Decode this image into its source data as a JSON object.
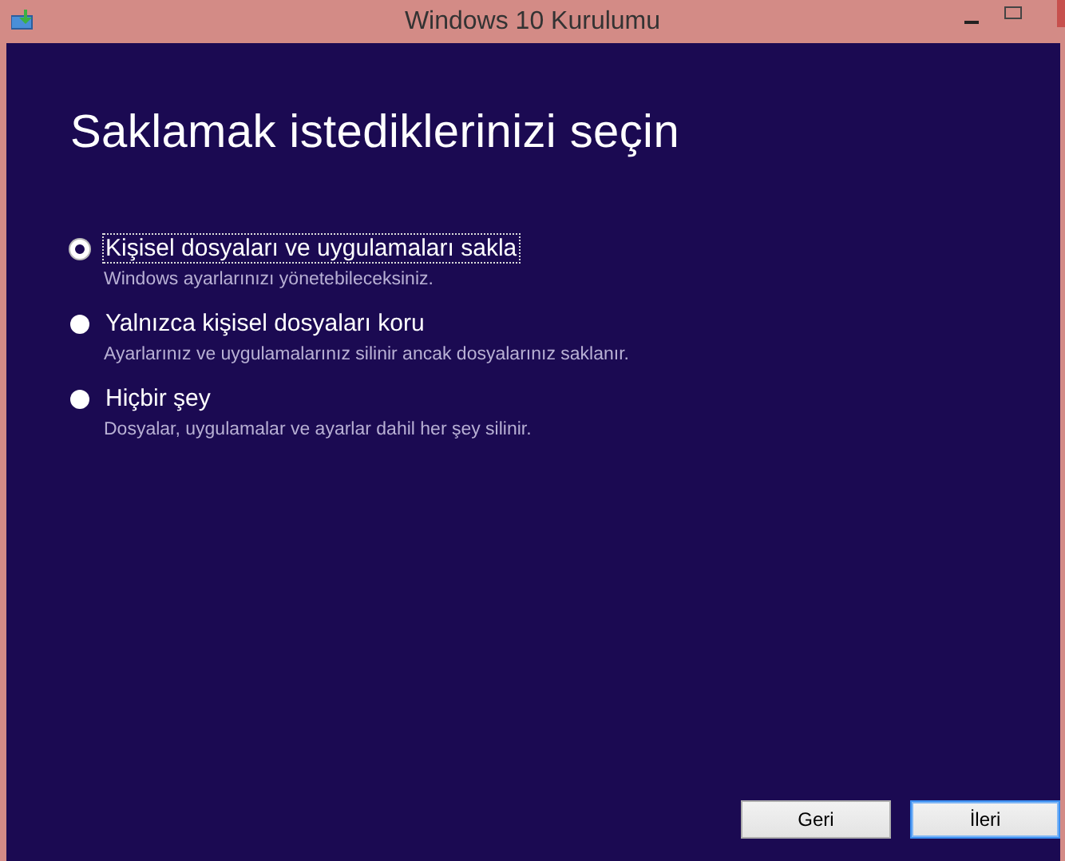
{
  "window": {
    "title": "Windows 10 Kurulumu"
  },
  "heading": "Saklamak istediklerinizi seçin",
  "options": [
    {
      "label": "Kişisel dosyaları ve uygulamaları sakla",
      "description": "Windows ayarlarınızı yönetebileceksiniz.",
      "selected": true
    },
    {
      "label": "Yalnızca kişisel dosyaları koru",
      "description": "Ayarlarınız ve uygulamalarınız silinir ancak dosyalarınız saklanır.",
      "selected": false
    },
    {
      "label": "Hiçbir şey",
      "description": "Dosyalar, uygulamalar ve ayarlar dahil her şey silinir.",
      "selected": false
    }
  ],
  "buttons": [
    {
      "label": "Geri",
      "focused": false
    },
    {
      "label": "İleri",
      "focused": true
    }
  ]
}
